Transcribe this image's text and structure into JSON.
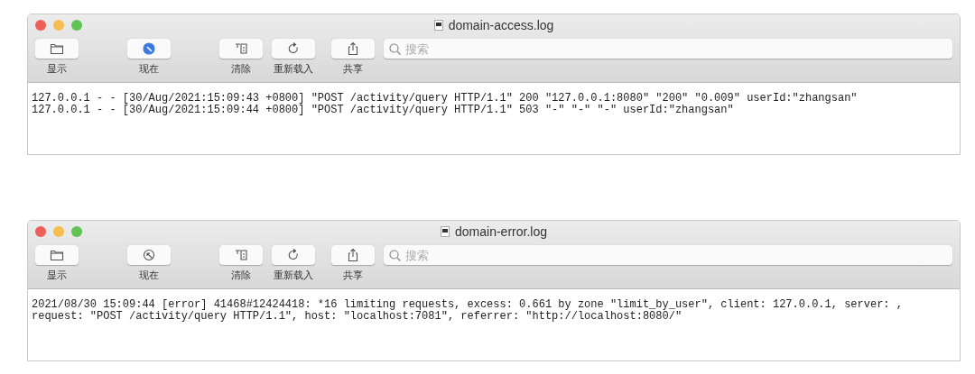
{
  "windows": [
    {
      "title": "domain-access.log",
      "toolbar": [
        {
          "kind": "folder",
          "label": "显示",
          "selected": false
        },
        {
          "kind": "now",
          "label": "现在",
          "selected": true
        },
        {
          "kind": "clear",
          "label": "清除",
          "selected": false
        },
        {
          "kind": "reload",
          "label": "重新载入",
          "selected": false
        },
        {
          "kind": "share",
          "label": "共享",
          "selected": false
        }
      ],
      "search": {
        "placeholder": "搜索"
      },
      "lines": [
        "127.0.0.1 - - [30/Aug/2021:15:09:43 +0800] \"POST /activity/query HTTP/1.1\" 200 \"127.0.0.1:8080\" \"200\" \"0.009\" userId:\"zhangsan\"",
        "127.0.0.1 - - [30/Aug/2021:15:09:44 +0800] \"POST /activity/query HTTP/1.1\" 503 \"-\" \"-\" \"-\" userId:\"zhangsan\""
      ]
    },
    {
      "title": "domain-error.log",
      "toolbar": [
        {
          "kind": "folder",
          "label": "显示",
          "selected": false
        },
        {
          "kind": "now",
          "label": "现在",
          "selected": false
        },
        {
          "kind": "clear",
          "label": "清除",
          "selected": false
        },
        {
          "kind": "reload",
          "label": "重新载入",
          "selected": false
        },
        {
          "kind": "share",
          "label": "共享",
          "selected": false
        }
      ],
      "search": {
        "placeholder": "搜索"
      },
      "lines": [
        "2021/08/30 15:09:44 [error] 41468#12424418: *16 limiting requests, excess: 0.661 by zone \"limit_by_user\", client: 127.0.0.1, server: ,",
        "request: \"POST /activity/query HTTP/1.1\", host: \"localhost:7081\", referrer: \"http://localhost:8080/\""
      ]
    }
  ]
}
